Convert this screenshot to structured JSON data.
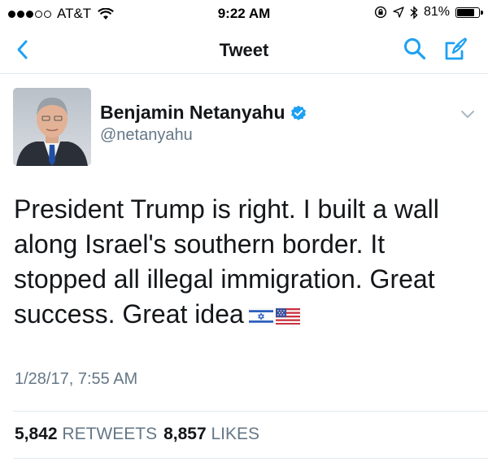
{
  "status_bar": {
    "carrier": "AT&T",
    "time": "9:22 AM",
    "battery_percent": "81%",
    "battery_level": 0.81,
    "signal_bars_filled": 3,
    "signal_bars_total": 5
  },
  "nav": {
    "title": "Tweet",
    "accent_color": "#1da1f2",
    "back_icon": "chevron-left-icon",
    "search_icon": "search-icon",
    "compose_icon": "compose-icon"
  },
  "tweet": {
    "author_name": "Benjamin Netanyahu",
    "author_handle": "@netanyahu",
    "verified": true,
    "text": "President Trump is right. I built a wall along Israel's southern border. It stopped all illegal immigration. Great success. Great idea",
    "emoji": [
      "israel-flag",
      "us-flag"
    ],
    "timestamp": "1/28/17, 7:55 AM",
    "retweets_count": "5,842",
    "retweets_label": "RETWEETS",
    "likes_count": "8,857",
    "likes_label": "LIKES"
  }
}
